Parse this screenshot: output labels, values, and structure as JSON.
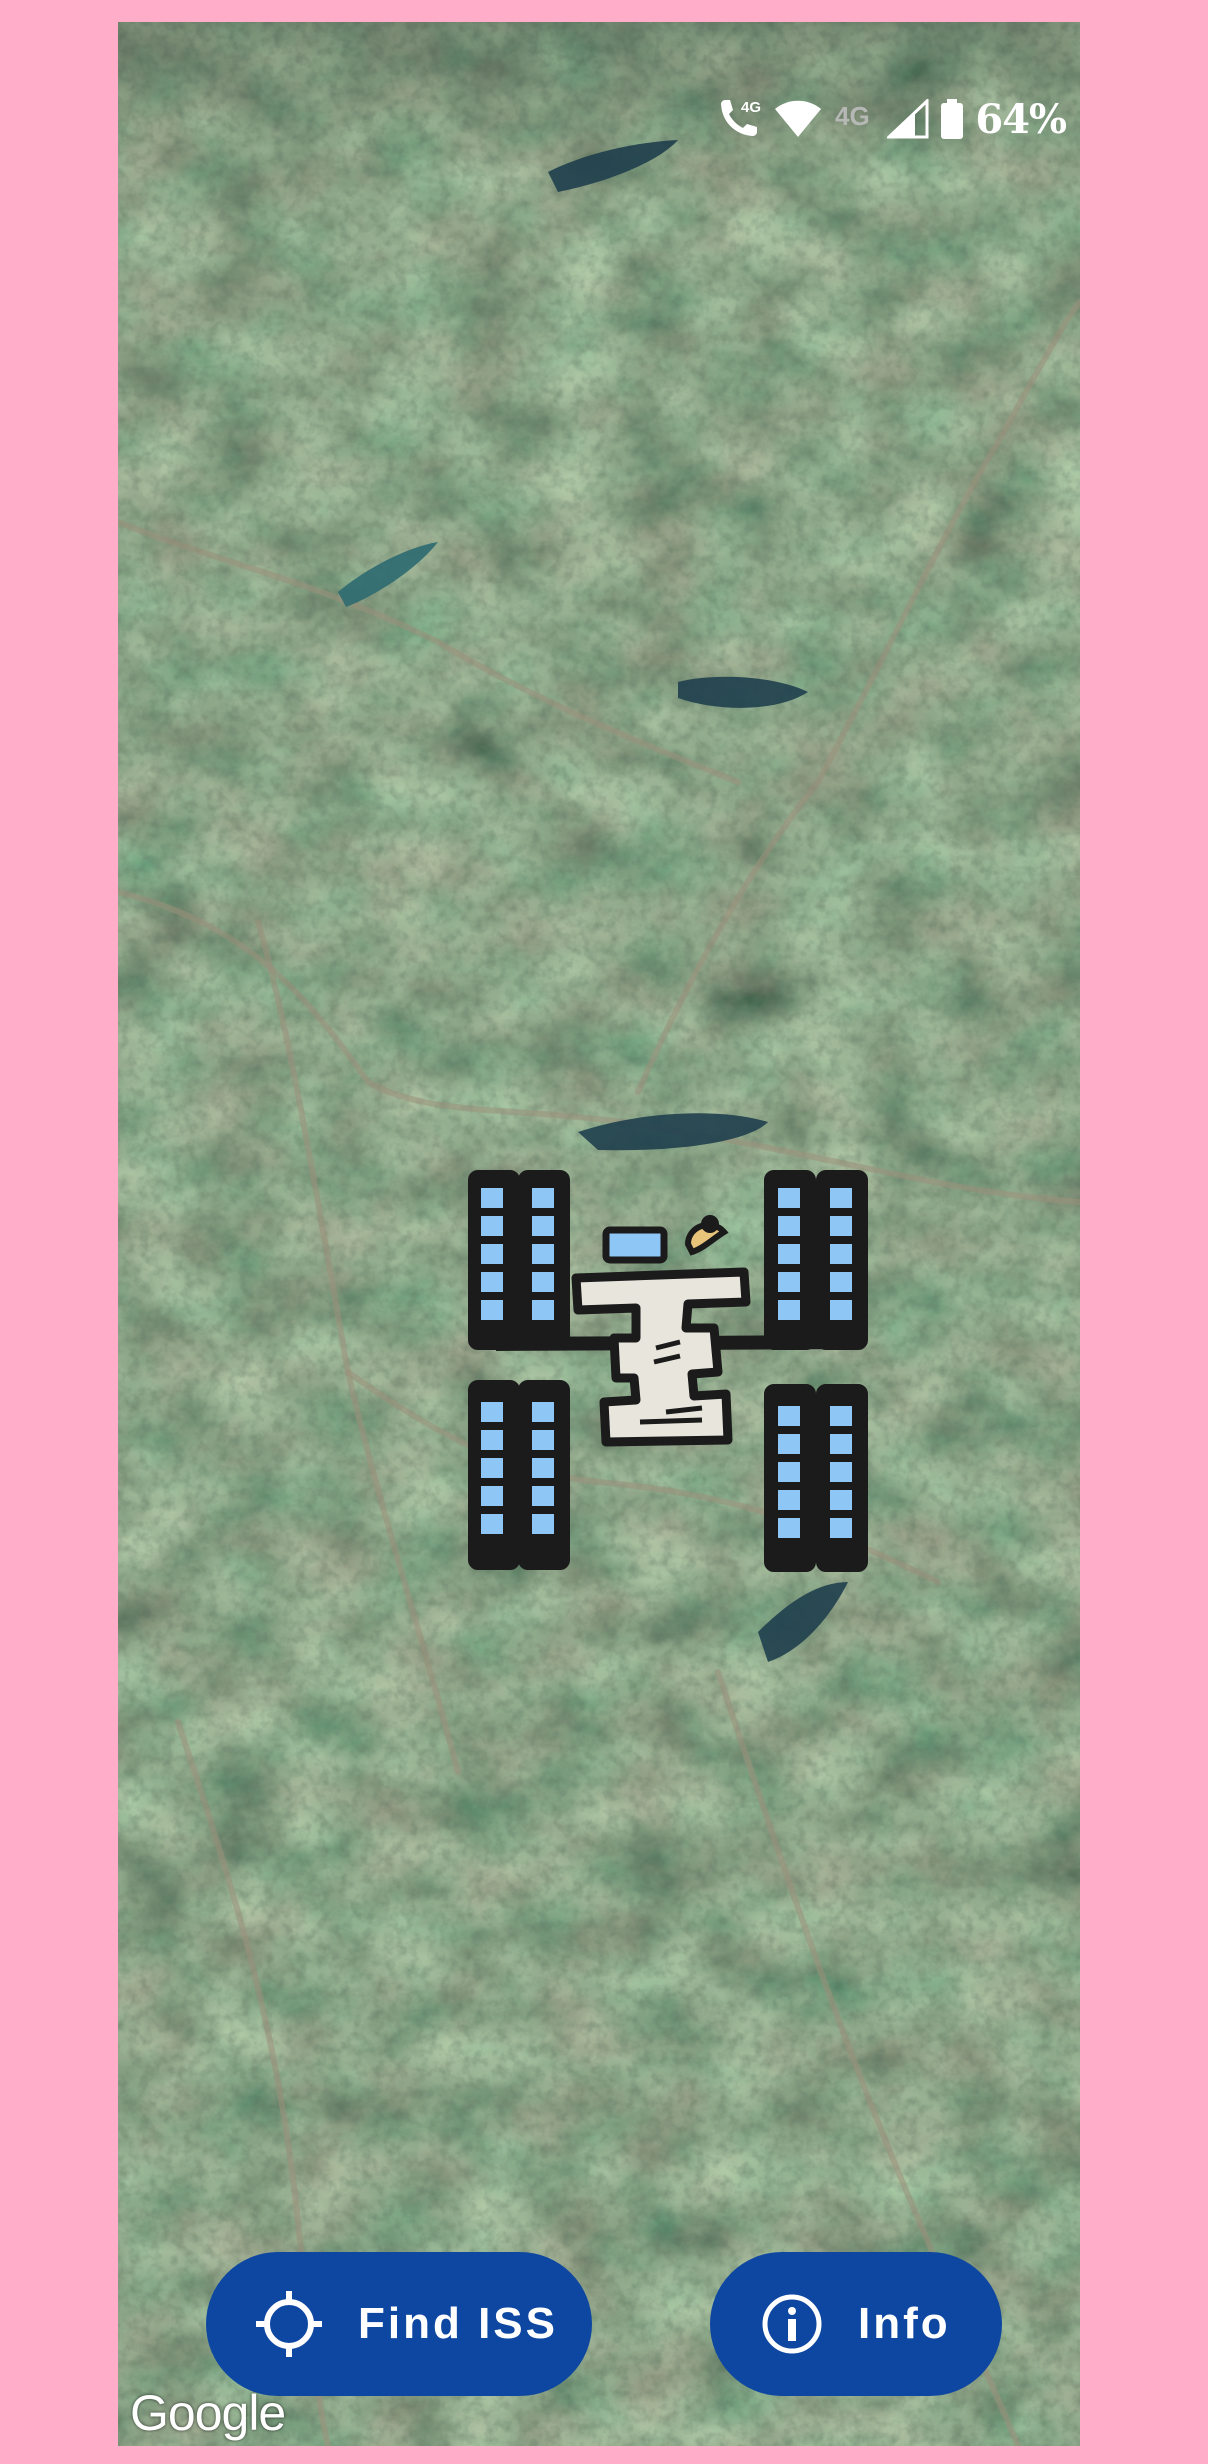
{
  "status_bar": {
    "call_network_label": "4G",
    "data_network_label": "4G",
    "battery_percent": "64%",
    "icons": [
      "wifi-calling-4g-icon",
      "wifi-icon",
      "mobile-data-4g-icon",
      "cell-signal-icon",
      "battery-icon"
    ]
  },
  "map": {
    "type": "satellite",
    "attribution": "Google"
  },
  "marker": {
    "icon": "iss-station-icon"
  },
  "actions": {
    "find_label": "Find ISS",
    "find_icon": "crosshair-icon",
    "info_label": "Info",
    "info_icon": "info-circle-icon"
  },
  "colors": {
    "page_background": "#ffadc8",
    "button_background": "#0e47a1",
    "button_text": "#ffffff",
    "solar_panel": "#8ec6f5",
    "module_body": "#e8e5dc",
    "dish": "#e8c47a"
  }
}
